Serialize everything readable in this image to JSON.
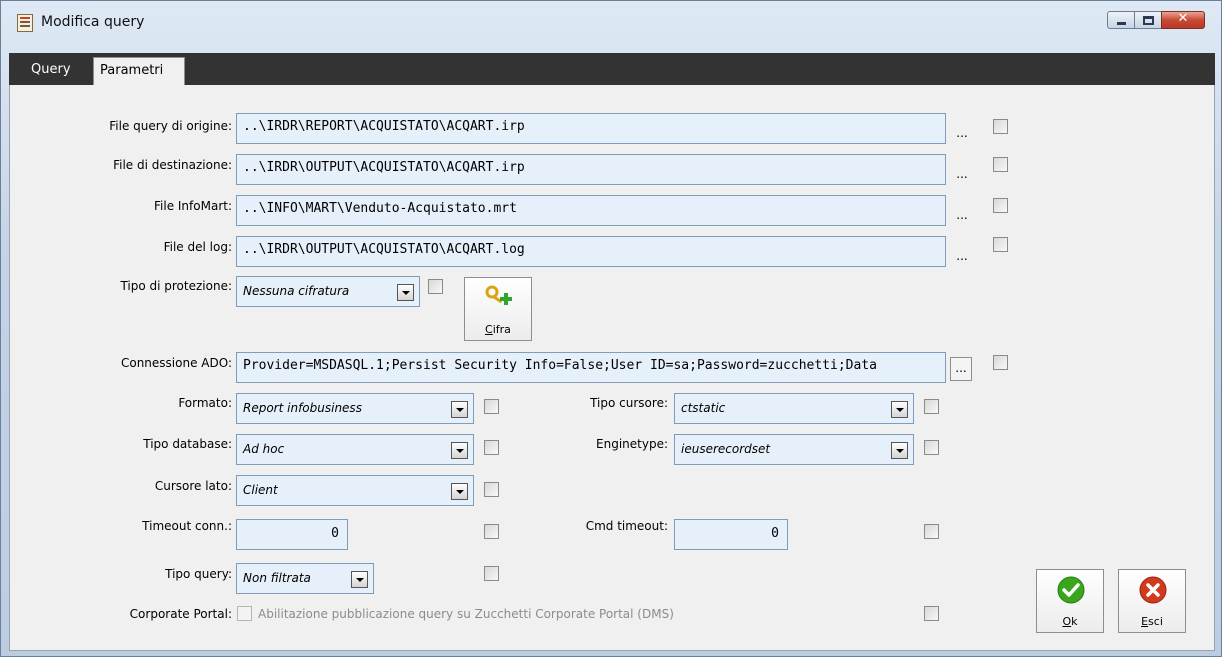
{
  "window": {
    "title": "Modifica query"
  },
  "tabs": [
    {
      "label": "Query"
    },
    {
      "label": "Parametri"
    }
  ],
  "fields": {
    "origin": {
      "label": "File query di origine:",
      "value": "..\\IRDR\\REPORT\\ACQUISTATO\\ACQART.irp"
    },
    "destination": {
      "label": "File di destinazione:",
      "value": "..\\IRDR\\OUTPUT\\ACQUISTATO\\ACQART.irp"
    },
    "infomart": {
      "label": "File InfoMart:",
      "value": "..\\INFO\\MART\\Venduto-Acquistato.mrt"
    },
    "log": {
      "label": "File del log:",
      "value": "..\\IRDR\\OUTPUT\\ACQUISTATO\\ACQART.log"
    },
    "protection": {
      "label": "Tipo di protezione:",
      "value": "Nessuna cifratura"
    },
    "ado": {
      "label": "Connessione ADO:",
      "value": "Provider=MSDASQL.1;Persist Security Info=False;User ID=sa;Password=zucchetti;Data"
    },
    "formato": {
      "label": "Formato:",
      "value": "Report infobusiness"
    },
    "tipo_cursore": {
      "label": "Tipo cursore:",
      "value": "ctstatic"
    },
    "tipo_database": {
      "label": "Tipo database:",
      "value": "Ad hoc"
    },
    "enginetype": {
      "label": "Enginetype:",
      "value": "ieuserecordset"
    },
    "cursore_lato": {
      "label": "Cursore lato:",
      "value": "Client"
    },
    "timeout_conn": {
      "label": "Timeout conn.:",
      "value": "0"
    },
    "cmd_timeout": {
      "label": "Cmd timeout:",
      "value": "0"
    },
    "tipo_query": {
      "label": "Tipo query:",
      "value": "Non filtrata"
    },
    "corporate": {
      "label": "Corporate Portal:",
      "value": "Abilitazione pubblicazione query su Zucchetti Corporate Portal (DMS)"
    }
  },
  "buttons": {
    "ellipsis": "...",
    "cifra_key": "C",
    "cifra_rest": "ifra",
    "ok_key": "O",
    "ok_rest": "k",
    "esci_key": "E",
    "esci_rest": "sci"
  },
  "colors": {
    "tab_bar": "#333333",
    "field_bg": "#e6f0fa",
    "ok_green": "#3aa61e",
    "esci_red": "#d23a1e",
    "close_red": "#c84a34"
  }
}
